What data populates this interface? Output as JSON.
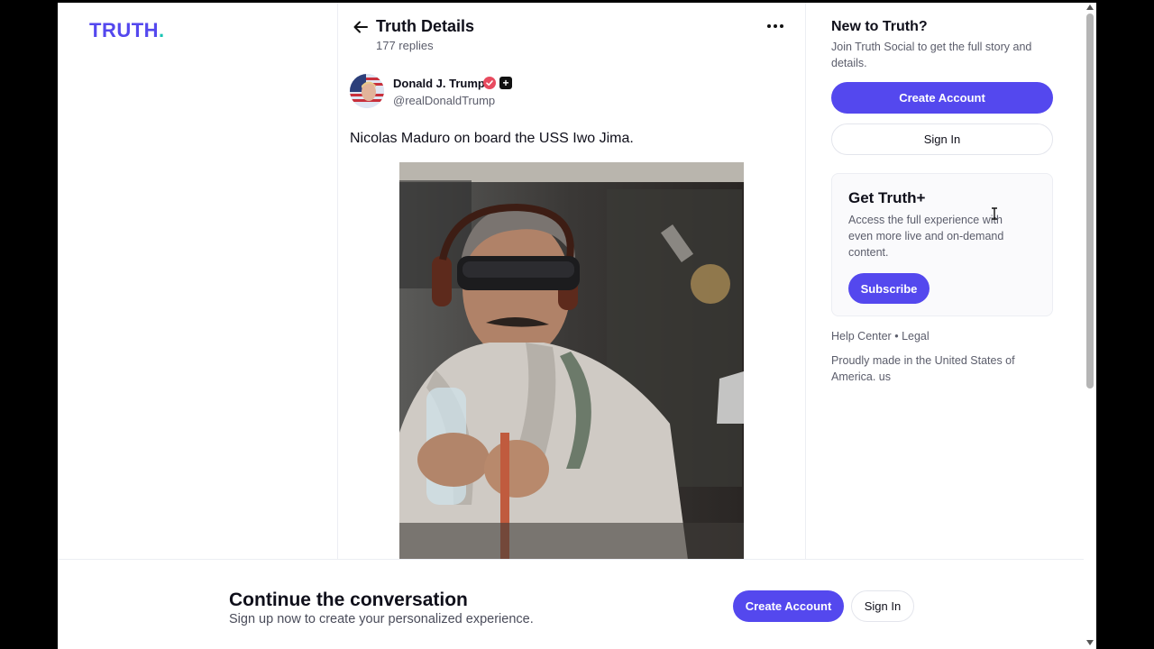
{
  "app": {
    "logo_text": "TRUTH",
    "logo_dot": ".",
    "brand_color": "#5448ee",
    "accent_color": "#19c4b4"
  },
  "header": {
    "title": "Truth Details",
    "replies": "177 replies",
    "back_icon": "arrow-left-icon",
    "more_icon": "ellipsis-icon"
  },
  "post": {
    "author_name": "Donald J. Trump",
    "author_handle": "@realDonaldTrump",
    "verified_icon": "verified-check-icon",
    "plus_badge": "+",
    "text": "Nicolas Maduro on board the USS Iwo Jima."
  },
  "sidebar": {
    "new_title": "New to Truth?",
    "new_desc": "Join Truth Social to get the full story and details.",
    "create_account": "Create Account",
    "sign_in": "Sign In",
    "truthplus_title": "Get Truth+",
    "truthplus_desc": "Access the full experience with even more live and on-demand content.",
    "subscribe": "Subscribe",
    "help_center": "Help Center",
    "separator": "•",
    "legal": "Legal",
    "made_in": "Proudly made in the United States of America. us"
  },
  "banner": {
    "title": "Continue the conversation",
    "subtitle": "Sign up now to create your personalized experience.",
    "create_account": "Create Account",
    "sign_in": "Sign In"
  }
}
